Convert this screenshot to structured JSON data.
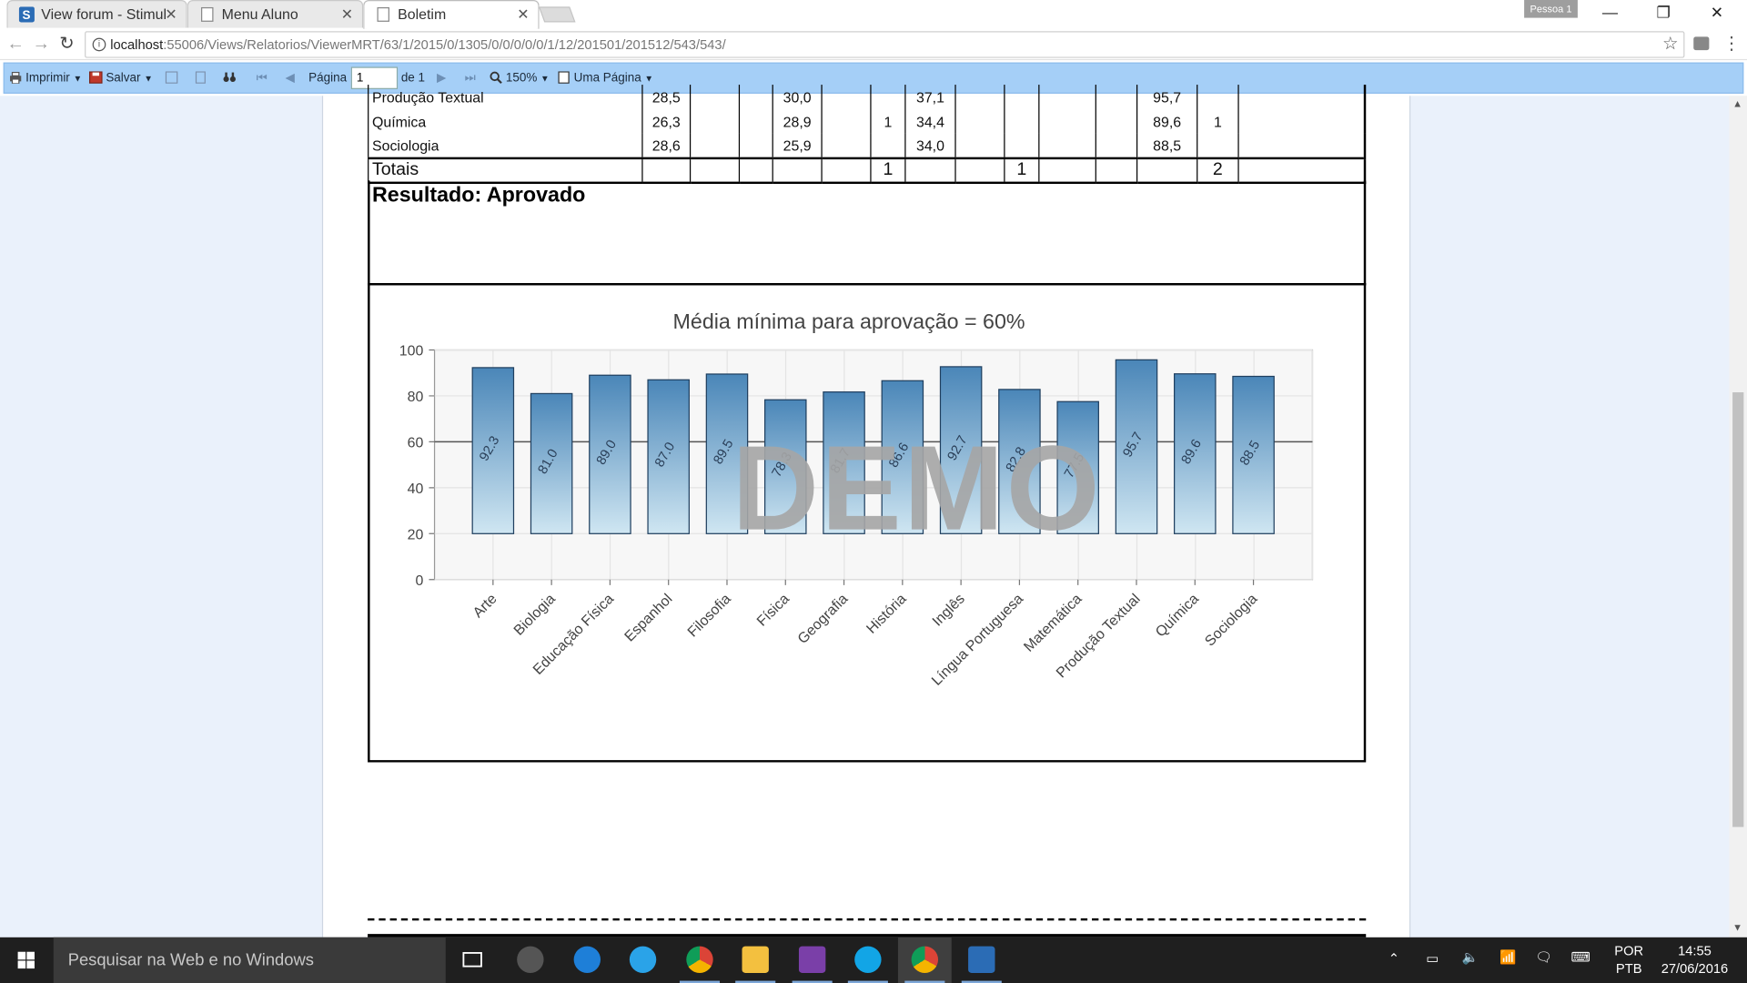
{
  "browser": {
    "tabs": [
      {
        "label": "View forum - Stimul",
        "active": false
      },
      {
        "label": "Menu Aluno",
        "active": false
      },
      {
        "label": "Boletim",
        "active": true
      }
    ],
    "profile_label": "Pessoa 1",
    "url_host": "localhost",
    "url_path": ":55006/Views/Relatorios/ViewerMRT/63/1/2015/0/1305/0/0/0/0/0/1/12/201501/201512/543/543/"
  },
  "toolbar": {
    "print_label": "Imprimir",
    "save_label": "Salvar",
    "page_label": "Página",
    "page_value": "1",
    "page_of": "de 1",
    "zoom_label": "150%",
    "view_mode_label": "Uma Página"
  },
  "report": {
    "rows": [
      {
        "subject": "Produção Textual",
        "c1": "28,5",
        "c2": "",
        "c3": "",
        "c4": "30,0",
        "c5": "",
        "c6": "",
        "c7": "37,1",
        "c8": "",
        "c9": "",
        "c10": "",
        "c11": "",
        "c12": "95,7",
        "c13": "",
        "c14": ""
      },
      {
        "subject": "Química",
        "c1": "26,3",
        "c2": "",
        "c3": "",
        "c4": "28,9",
        "c5": "",
        "c6": "1",
        "c7": "34,4",
        "c8": "",
        "c9": "",
        "c10": "",
        "c11": "",
        "c12": "89,6",
        "c13": "1",
        "c14": ""
      },
      {
        "subject": "Sociologia",
        "c1": "28,6",
        "c2": "",
        "c3": "",
        "c4": "25,9",
        "c5": "",
        "c6": "",
        "c7": "34,0",
        "c8": "",
        "c9": "",
        "c10": "",
        "c11": "",
        "c12": "88,5",
        "c13": "",
        "c14": ""
      }
    ],
    "totals": {
      "label": "Totais",
      "c6": "1",
      "c9": "1",
      "c13": "2"
    },
    "result_text": "Resultado: Aprovado",
    "watermark": "DEMO"
  },
  "chart_data": {
    "type": "bar",
    "title": "Média mínima para aprovação = 60%",
    "categories": [
      "Arte",
      "Biologia",
      "Educação Física",
      "Espanhol",
      "Filosofia",
      "Física",
      "Geografia",
      "História",
      "Inglês",
      "Língua Portuguesa",
      "Matemática",
      "Produção Textual",
      "Química",
      "Sociologia"
    ],
    "values": [
      92.3,
      81.0,
      89.0,
      87.0,
      89.5,
      78.3,
      81.7,
      86.6,
      92.7,
      82.8,
      77.5,
      95.7,
      89.6,
      88.5
    ],
    "value_labels": [
      "92.3",
      "81.0",
      "89.0",
      "87.0",
      "89.5",
      "78.3",
      "81.7",
      "86.6",
      "92.7",
      "82.8",
      "77.5",
      "95.7",
      "89.6",
      "88.5"
    ],
    "yticks": [
      "0",
      "20",
      "40",
      "60",
      "80",
      "100"
    ],
    "ylim": [
      0,
      100
    ],
    "reference_line": 60,
    "bar_base": 20,
    "bar_color": "#4a86b8",
    "grid": true,
    "xlabel": "",
    "ylabel": ""
  },
  "taskbar": {
    "search_placeholder": "Pesquisar na Web e no Windows",
    "lang_line1": "POR",
    "lang_line2": "PTB",
    "time": "14:55",
    "date": "27/06/2016"
  }
}
